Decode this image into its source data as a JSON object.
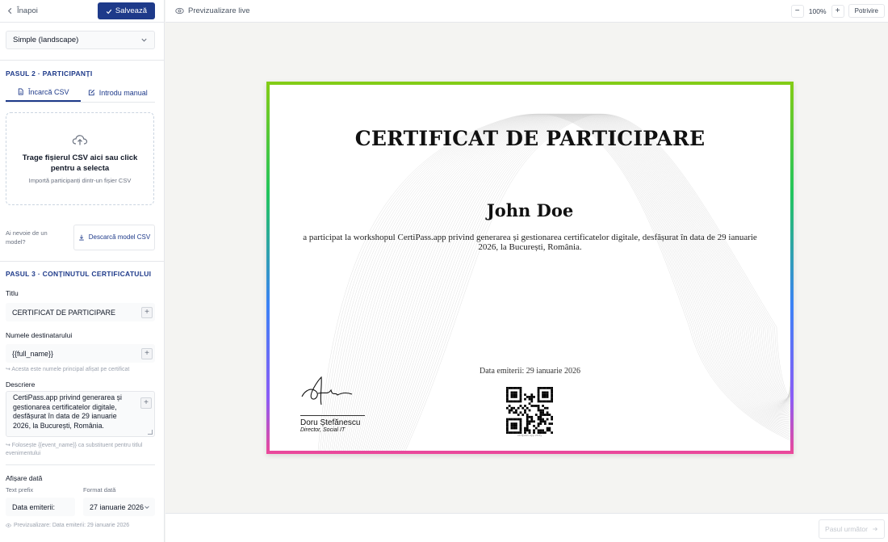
{
  "sidebar": {
    "back_label": "Înapoi",
    "save_label": "Salvează",
    "template_select": "Simple (landscape)",
    "step2": {
      "title": "PASUL 2 · PARTICIPANȚI",
      "tab_upload": "Încarcă CSV",
      "tab_manual": "Introdu manual",
      "dropzone_title": "Trage fișierul CSV aici sau click pentru a selecta",
      "dropzone_subtitle": "Importă participanți dintr-un fișier CSV",
      "model_question": "Ai nevoie de un model?",
      "download_model": "Descarcă model CSV"
    },
    "step3": {
      "title": "PASUL 3 · CONȚINUTUL CERTIFICATULUI",
      "title_label": "Titlu",
      "title_value": "CERTIFICAT DE PARTICIPARE",
      "recipient_label": "Numele destinatarului",
      "recipient_value": "{{full_name}}",
      "recipient_hint": "↪ Acesta este numele principal afișat pe certificat",
      "description_label": "Descriere",
      "description_value": "CertiPass.app privind generarea și gestionarea certificatelor digitale, desfășurat în data de 29 ianuarie 2026, la București, România.",
      "description_hint": "↪ Folosește {{event_name}} ca substituent pentru titlul evenimentului",
      "date_section": "Afișare dată",
      "prefix_label": "Text prefix",
      "prefix_value": "Data emiterii:",
      "format_label": "Format dată",
      "format_value": "27 ianuarie 2026",
      "preview_text": "Previzualizare: Data emiterii: 29 ianuarie 2026"
    }
  },
  "toolbar": {
    "live_preview": "Previzualizare live",
    "zoom_out": "−",
    "zoom_value": "100%",
    "zoom_in": "+",
    "fit_label": "Potrivire"
  },
  "footer": {
    "next_label": "Pasul următor"
  },
  "certificate": {
    "title": "CERTIFICAT DE PARTICIPARE",
    "name": "John Doe",
    "description": "a participat la workshopul CertiPass.app privind generarea și gestionarea certificatelor digitale, desfășurat în data de 29 ianuarie 2026, la București, România.",
    "issue_date": "Data emiterii: 29 ianuarie 2026",
    "signer_name": "Doru Ștefănescu",
    "signer_role": "Director, Social IT",
    "qr_caption": "certipass.app verify"
  },
  "colors": {
    "brand": "#1e3a8a",
    "border_gradient": [
      "#84cc16",
      "#facc15",
      "#f97316",
      "#ec4899",
      "#8b5cf6"
    ]
  }
}
